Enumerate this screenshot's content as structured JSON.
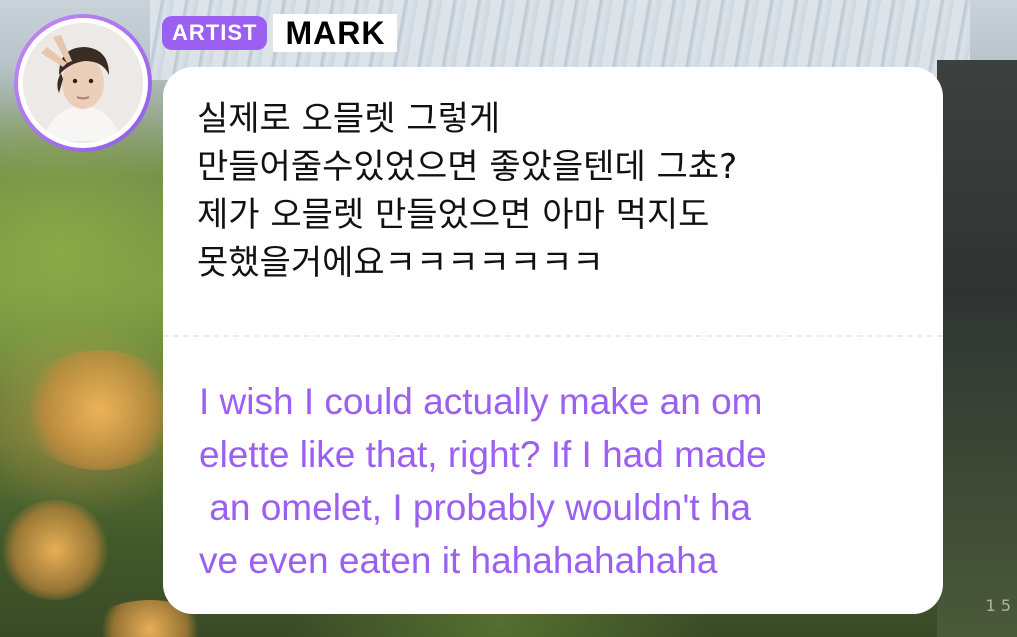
{
  "author": {
    "badge": "ARTIST",
    "name": "MARK"
  },
  "message": {
    "original_lines": [
      "실제로 오믈렛 그렇게",
      "만들어줄수있었으면 좋았을텐데 그쵸?",
      "제가 오믈렛 만들었으면 아마 먹지도",
      "못했을거에요ㅋㅋㅋㅋㅋㅋㅋ"
    ],
    "translation_lines": [
      "I wish I could actually make an om",
      "elette like that, right? If I had made",
      " an omelet, I probably wouldn't ha",
      "ve even eaten it hahahahahaha"
    ]
  },
  "colors": {
    "accent": "#9b5ff2",
    "bubble": "#ffffff",
    "text": "#111111"
  },
  "icons": {
    "avatar": "profile-photo"
  },
  "page_indicator": "1 5"
}
